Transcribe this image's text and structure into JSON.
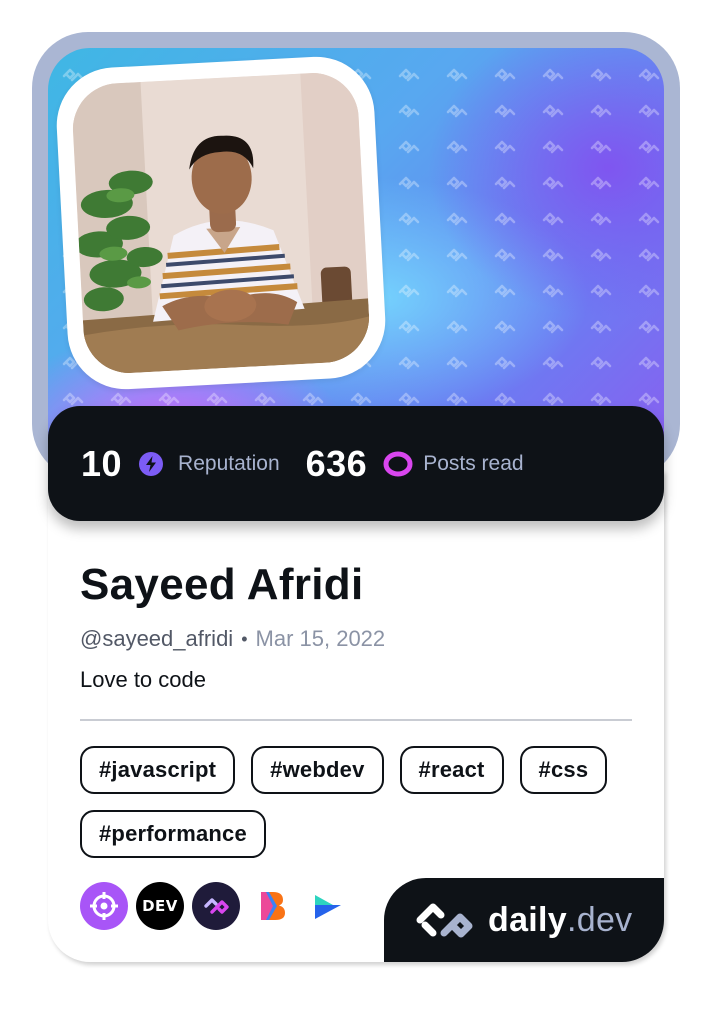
{
  "profile": {
    "name": "Sayeed Afridi",
    "handle": "@sayeed_afridi",
    "separator": "•",
    "joined": "Mar 15, 2022",
    "bio": "Love to code"
  },
  "stats": {
    "reputation_value": "10",
    "reputation_label": "Reputation",
    "posts_value": "636",
    "posts_label": "Posts read",
    "reputation_icon": "reputation-bolt-icon",
    "posts_icon": "posts-read-eye-icon"
  },
  "tags": [
    "#javascript",
    "#webdev",
    "#react",
    "#css",
    "#performance"
  ],
  "sources": [
    {
      "icon": "target-source-icon",
      "color": "#a855f7"
    },
    {
      "icon": "dev-to-source-icon",
      "label": "DEV",
      "color": "#000000"
    },
    {
      "icon": "daily-dev-source-icon",
      "color": "#1f1b3a"
    },
    {
      "icon": "b-logo-source-icon",
      "color": "#f97316"
    },
    {
      "icon": "arrow-logo-source-icon",
      "color": "#2563eb"
    }
  ],
  "brand": {
    "name": "daily",
    "tld": ".dev",
    "icon": "daily-dev-logo-icon"
  },
  "colors": {
    "card_dark": "#0e1217",
    "accent_purple": "#7c5cf5",
    "accent_magenta": "#d946ef",
    "frame": "#aab6d3"
  }
}
